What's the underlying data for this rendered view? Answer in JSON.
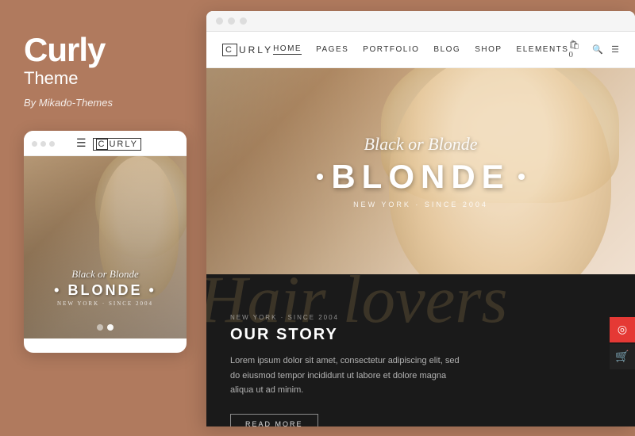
{
  "left": {
    "brand_title": "Curly",
    "brand_subtitle": "Theme",
    "brand_author": "By Mikado-Themes"
  },
  "mobile": {
    "logo_c": "C",
    "logo_text": "URLY",
    "script_text": "Black or Blonde",
    "blonde_text": "•BLONDE•",
    "tagline": "NEW YORK · SINCE 2004"
  },
  "desktop": {
    "browser_dots": [
      "dot1",
      "dot2",
      "dot3"
    ],
    "nav": {
      "logo_c": "C",
      "logo_text": "URLY",
      "links": [
        "HOME",
        "PAGES",
        "PORTFOLIO",
        "BLOG",
        "SHOP",
        "ELEMENTS"
      ]
    },
    "hero": {
      "script_text": "Black or Blonde",
      "main_text": "BLONDE",
      "tagline": "NEW YORK · SINCE 2004"
    },
    "story": {
      "script_bg": "Hair lovers",
      "since": "NEW YORK · SINCE 2004",
      "title": "OUR STORY",
      "body": "Lorem ipsum dolor sit amet, consectetur adipiscing elit, sed do eiusmod tempor incididunt ut labore et dolore magna aliqua ut ad minim.",
      "read_more": "READ MORE"
    }
  }
}
